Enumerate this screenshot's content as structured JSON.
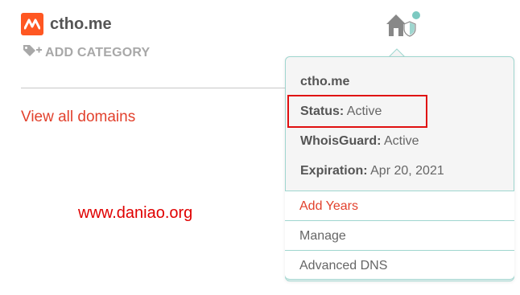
{
  "domain": {
    "name": "ctho.me",
    "logo_icon": "namecheap-logo-icon"
  },
  "add_category": {
    "label": "ADD CATEGORY",
    "icon": "tag-add-icon"
  },
  "view_all": "View all domains",
  "watermark": "www.daniao.org",
  "popover": {
    "title": "ctho.me",
    "status_label": "Status:",
    "status_value": "Active",
    "whois_label": "WhoisGuard:",
    "whois_value": "Active",
    "expiration_label": "Expiration:",
    "expiration_value": "Apr 20, 2021",
    "menu": [
      {
        "label": "Add Years"
      },
      {
        "label": "Manage"
      },
      {
        "label": "Advanced DNS"
      }
    ]
  },
  "colors": {
    "brand_orange": "#ff5722",
    "link_red": "#e2412d",
    "teal_border": "#9fd6cf",
    "highlight_red": "#e01010"
  }
}
